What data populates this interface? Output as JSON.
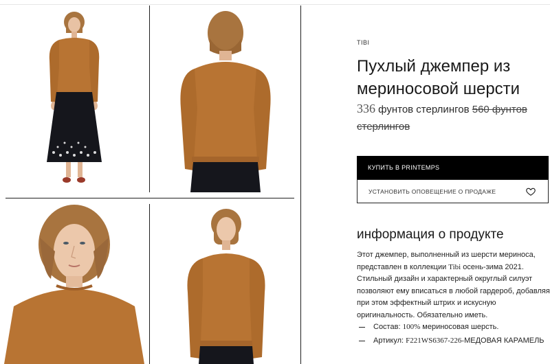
{
  "product": {
    "brand": "TIBI",
    "title": "Пухлый джемпер из мериносовой шерсти",
    "price_current_num": "336",
    "price_current_unit": "фунтов стерлингов",
    "price_old": "560 фунтов стерлингов",
    "buy_label": "КУПИТЬ В PRINTEMPS",
    "alert_label": "УСТАНОВИТЬ ОПОВЕЩЕНИЕ О ПРОДАЖЕ",
    "info_heading": "информация о продукте",
    "description_part1": "Этот джемпер, выполненный из шерсти мериноса, представлен в коллекции ",
    "description_brand": "Tibi",
    "description_part2": " осень-зима 2021. Стильный дизайн и характерный округлый силуэт позволяют ему вписаться в любой гардероб, добавляя при этом эффектный штрих и искусную оригинальность. Обязательно иметь.",
    "spec_composition_label": "Состав: ",
    "spec_composition_value": "100%",
    "spec_composition_rest": " мериносовая шерсть.",
    "spec_sku_label": "Артикул: ",
    "spec_sku_value": "F221WS6367-226-",
    "spec_sku_rest": "МЕДОВАЯ КАРАМЕЛЬ"
  },
  "icons": {
    "wishlist": "heart-icon"
  },
  "colors": {
    "sweater": "#b87433",
    "skirt": "#15161c",
    "hair": "#a8743f",
    "button": "#000000"
  }
}
